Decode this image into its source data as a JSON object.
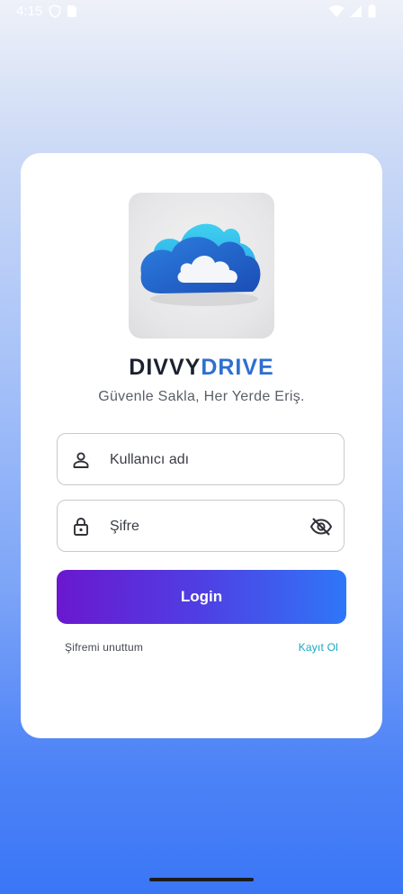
{
  "status_bar": {
    "time": "4:15",
    "icons_left": [
      "shield-icon",
      "sim-card-icon"
    ],
    "icons_right": [
      "wifi-icon",
      "cellular-signal-icon",
      "battery-icon"
    ]
  },
  "brand": {
    "name_part1": "DIVVY",
    "name_part2": "DRIVE",
    "tagline": "Güvenle Sakla, Her Yerde Eriş."
  },
  "form": {
    "username_placeholder": "Kullanıcı adı",
    "password_placeholder": "Şifre",
    "login_label": "Login"
  },
  "links": {
    "forgot_password": "Şifremi unuttum",
    "register": "Kayıt Ol"
  },
  "colors": {
    "accent_blue": "#2d6fd1",
    "button_gradient_start": "#6a18cf",
    "button_gradient_end": "#2f77f8",
    "link_teal": "#1aa6c3"
  }
}
